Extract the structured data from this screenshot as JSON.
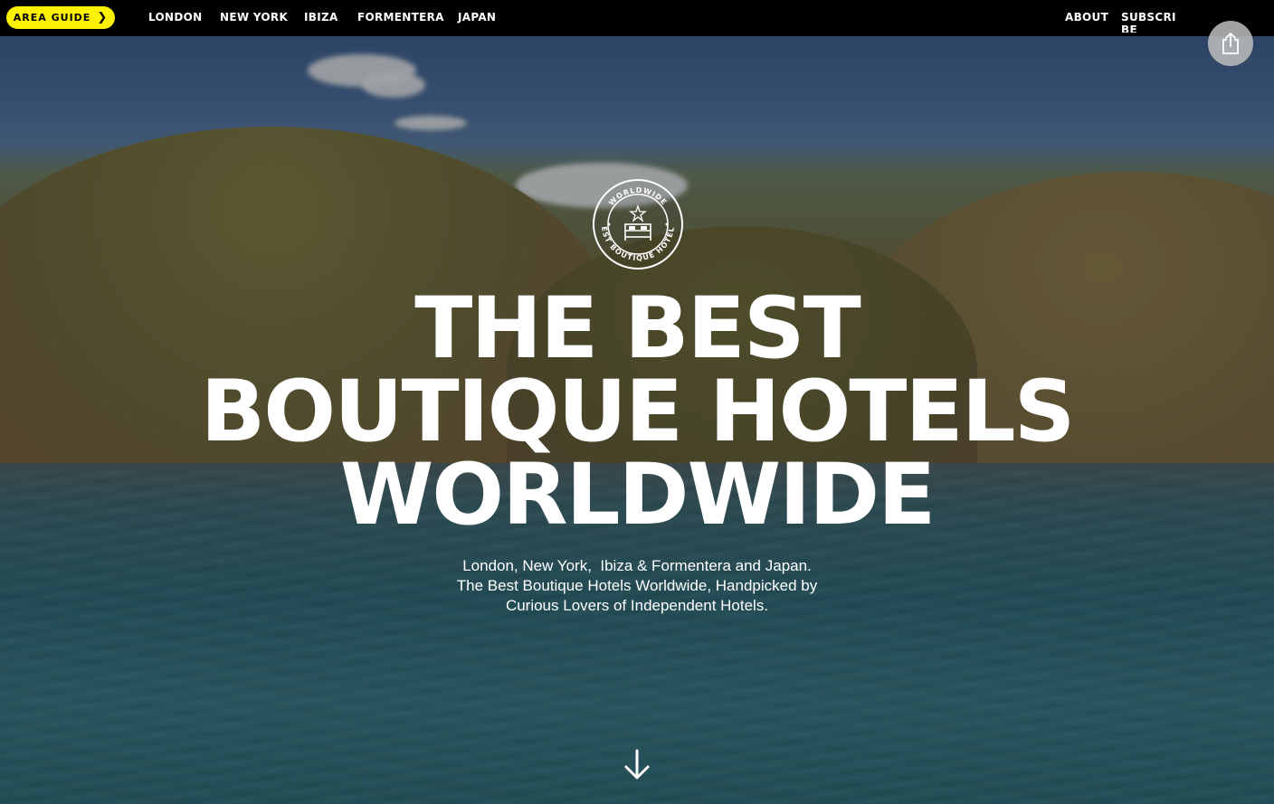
{
  "nav": {
    "area_guide_label": "AREA GUIDE",
    "items": [
      {
        "label": "LONDON"
      },
      {
        "label": "NEW YORK"
      },
      {
        "label": "IBIZA"
      },
      {
        "label": "FORMENTERA"
      },
      {
        "label": "JAPAN"
      }
    ],
    "about_label": "ABOUT",
    "subscribe_label": "SUBSCRIBE"
  },
  "badge": {
    "top_text": "WORLDWIDE",
    "bottom_text": "BEST BOUTIQUE HOTELS"
  },
  "hero": {
    "headline_line1": "THE BEST",
    "headline_line2": "BOUTIQUE HOTELS",
    "headline_line3": "WORLDWIDE",
    "sub_line1": "London, New York,  Ibiza & Formentera and Japan.",
    "sub_line2": "The Best Boutique Hotels Worldwide, Handpicked by",
    "sub_line3": "Curious Lovers of Independent Hotels."
  },
  "icons": {
    "share": "share-icon",
    "chevron": "chevron-right-icon",
    "scroll": "arrow-down-icon"
  },
  "colors": {
    "accent": "#fff200",
    "topbar": "#000000",
    "text": "#ffffff"
  }
}
